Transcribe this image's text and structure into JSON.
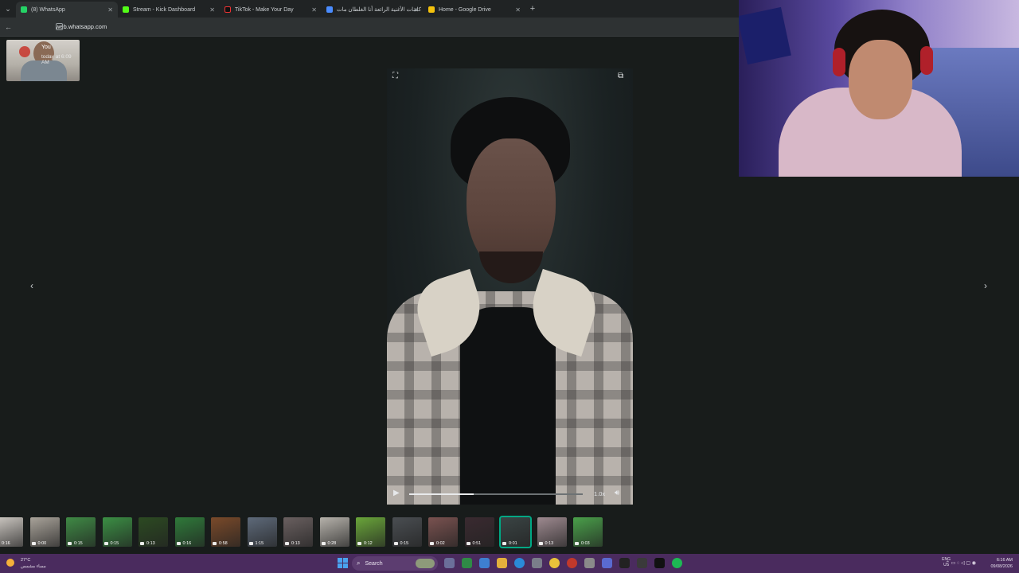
{
  "browser": {
    "tabs": [
      {
        "title": "(8) WhatsApp",
        "color": "#25d366",
        "active": true
      },
      {
        "title": "Stream - Kick Dashboard",
        "color": "#53fc18",
        "active": false
      },
      {
        "title": "TikTok - Make Your Day",
        "color": "#111111",
        "active": false
      },
      {
        "title": "كلمات الأغنية الرائعة أنا الغلطان مات",
        "color": "#4a8cff",
        "active": false
      },
      {
        "title": "Home - Google Drive",
        "color": "#f4c20d",
        "active": false
      }
    ],
    "new_tab": "+",
    "url": "web.whatsapp.com"
  },
  "viewer": {
    "sender": "You",
    "time": "today at 6:09 AM",
    "progress": 0.37,
    "speed": "1.0x"
  },
  "thumbnails": [
    {
      "dur": "0:16",
      "color": "#cfcac4"
    },
    {
      "dur": "0:00",
      "color": "#a9a39a"
    },
    {
      "dur": "0:15",
      "color": "#3f8a45"
    },
    {
      "dur": "0:15",
      "color": "#3b8f44"
    },
    {
      "dur": "0:13",
      "color": "#2c4a22"
    },
    {
      "dur": "0:16",
      "color": "#2f7a3a"
    },
    {
      "dur": "0:58",
      "color": "#7a4a2a"
    },
    {
      "dur": "1:15",
      "color": "#5e6a7a"
    },
    {
      "dur": "0:13",
      "color": "#6a6060"
    },
    {
      "dur": "0:28",
      "color": "#b6b2ab"
    },
    {
      "dur": "0:12",
      "color": "#6aa63a"
    },
    {
      "dur": "0:15",
      "color": "#4a4e52"
    },
    {
      "dur": "0:02",
      "color": "#7a5250"
    },
    {
      "dur": "0:51",
      "color": "#3a2a30"
    },
    {
      "dur": "0:01",
      "color": "#3a4444",
      "selected": true
    },
    {
      "dur": "0:13",
      "color": "#9e8a90"
    },
    {
      "dur": "0:03",
      "color": "#4aa04a"
    }
  ],
  "taskbar": {
    "weather_temp": "27°C",
    "weather_desc": "مساء مشمس",
    "search": "Search",
    "lang_top": "ENG",
    "lang_bottom": "US",
    "time": "6:16 AM",
    "date": "09/08/2026"
  },
  "colors": {
    "accent": "#00a884",
    "taskbar": "#4a2b5e"
  }
}
